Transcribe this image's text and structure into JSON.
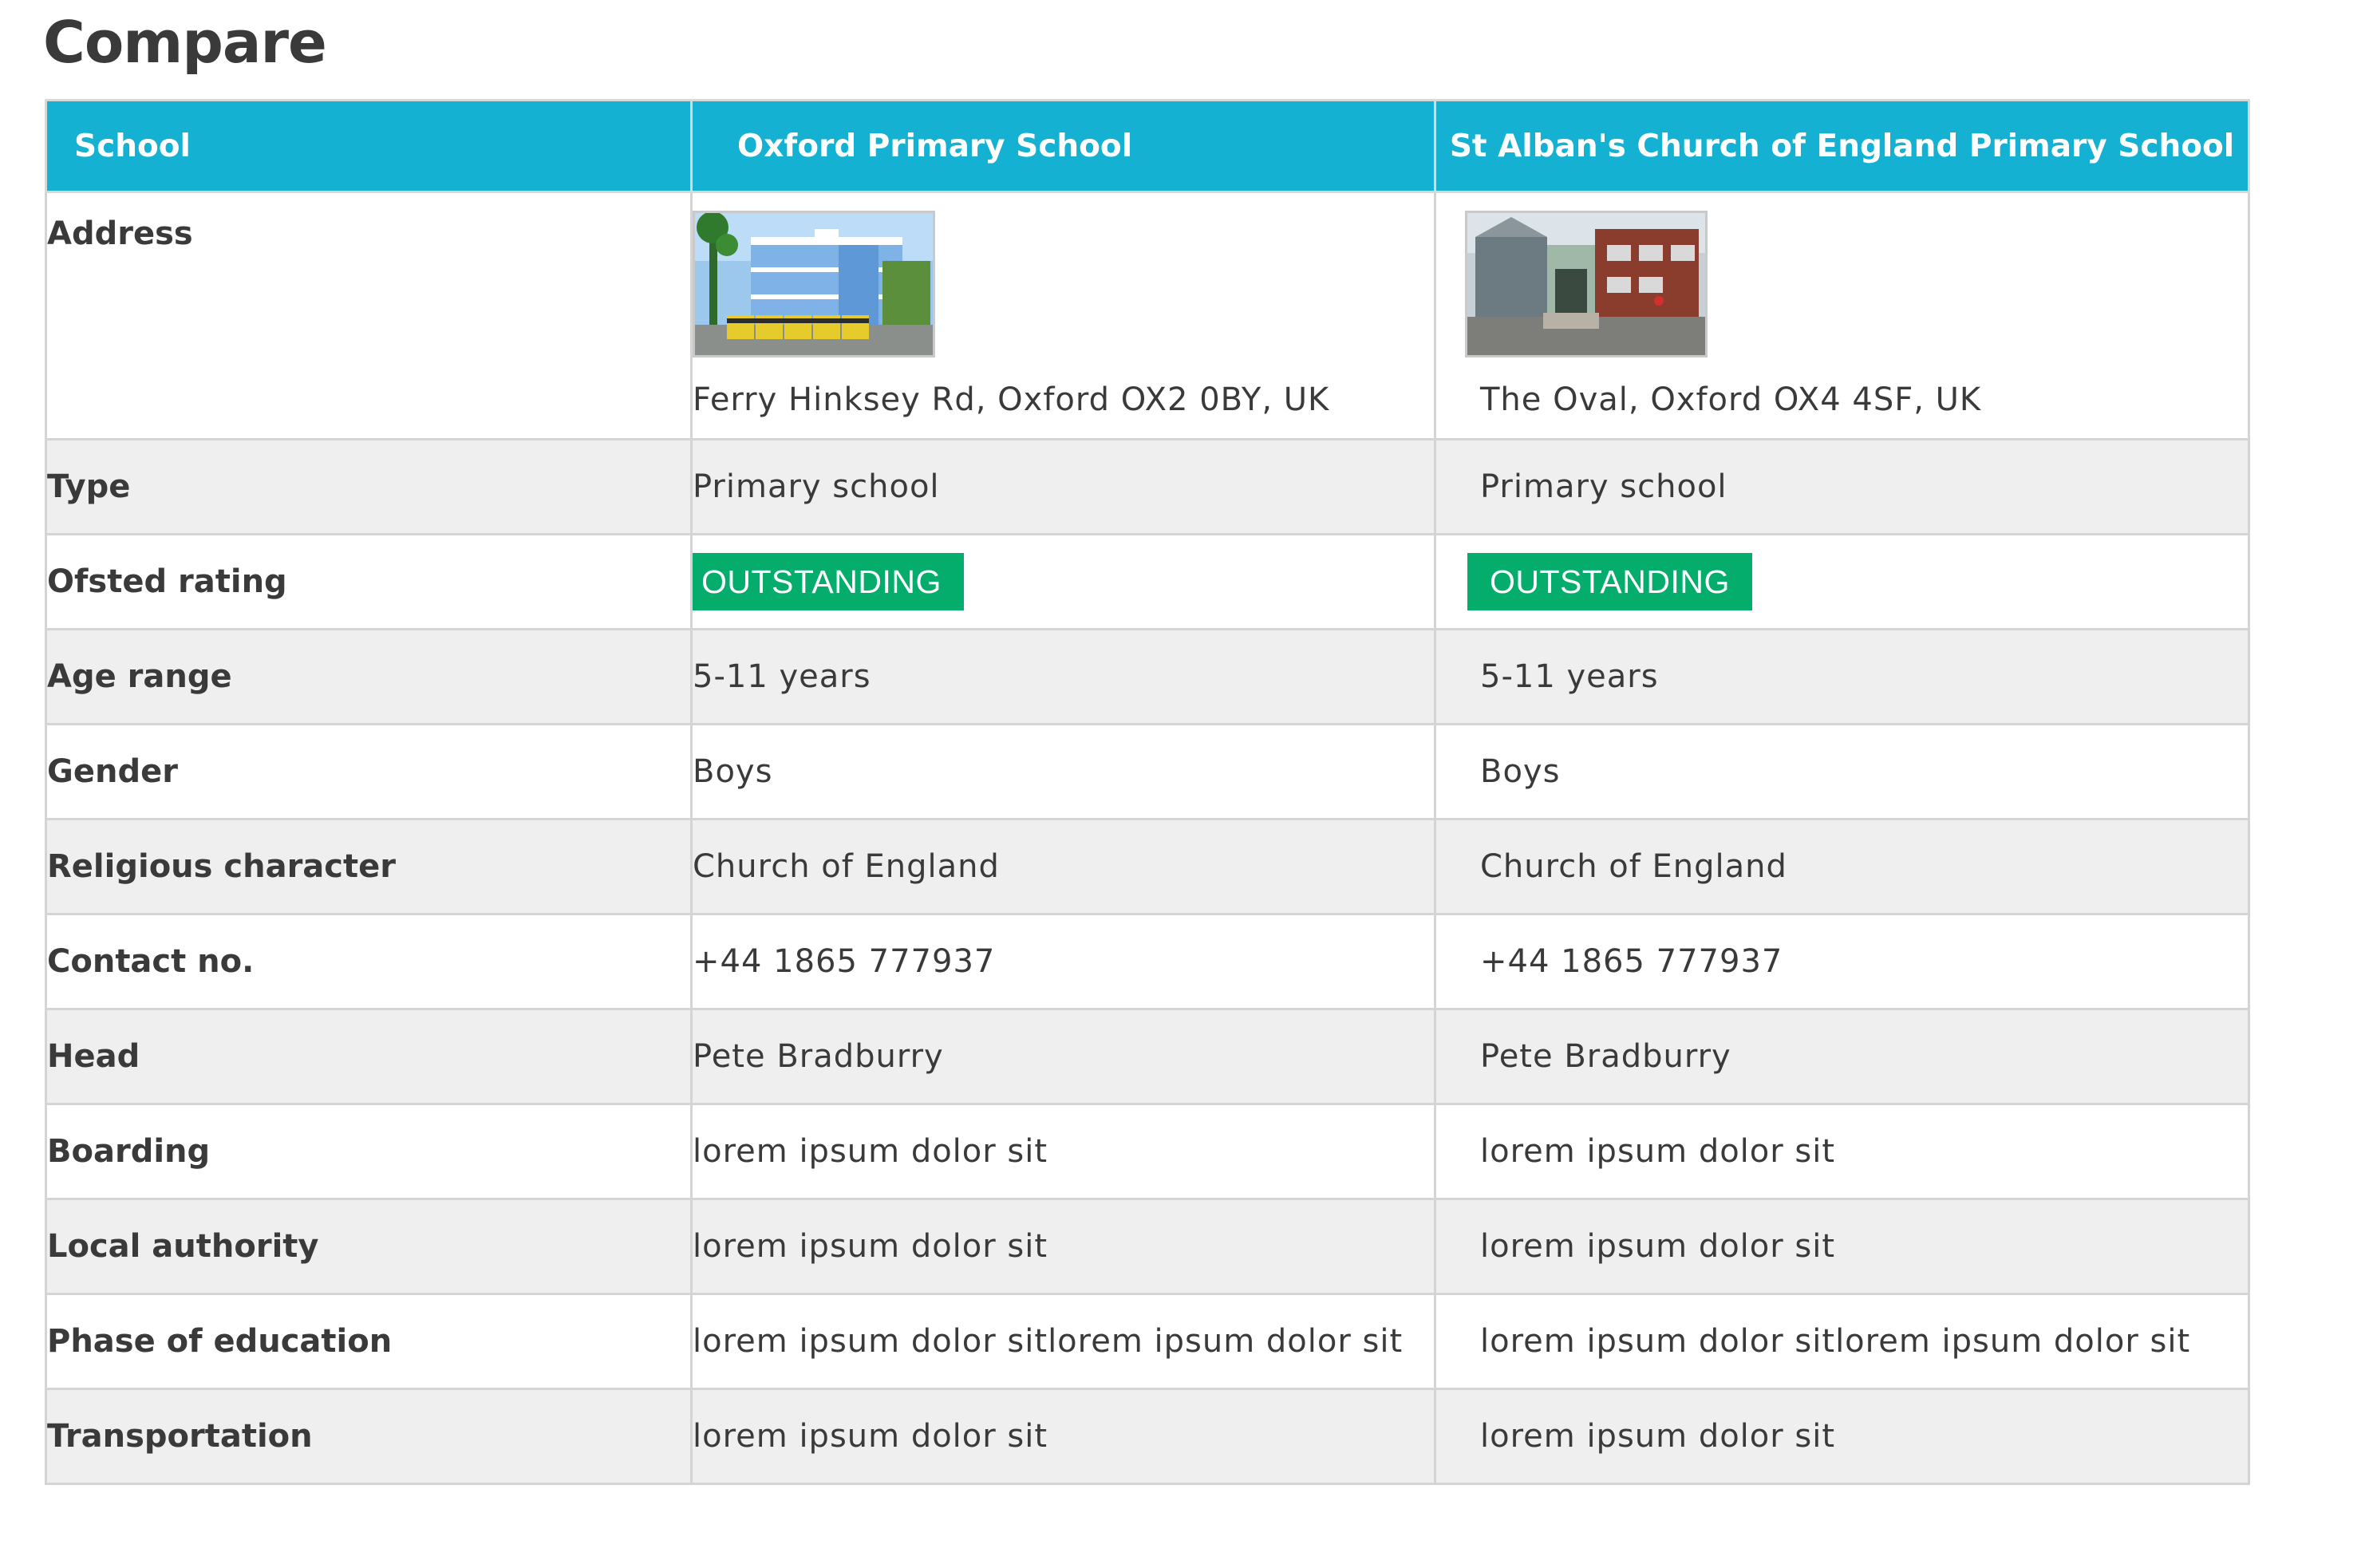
{
  "page": {
    "title": "Compare"
  },
  "table": {
    "headers": {
      "label": "School",
      "school_a": "Oxford Primary School",
      "school_b": "St Alban's Church of England Primary School"
    },
    "address": {
      "label": "Address",
      "school_a": "Ferry Hinksey Rd, Oxford OX2 0BY, UK",
      "school_b": "The Oval, Oxford OX4 4SF, UK"
    },
    "type": {
      "label": "Type",
      "school_a": "Primary school",
      "school_b": "Primary school"
    },
    "ofsted": {
      "label": "Ofsted rating",
      "school_a": "OUTSTANDING",
      "school_b": "OUTSTANDING",
      "badge_color": "#05ad6c"
    },
    "age_range": {
      "label": "Age range",
      "school_a": "5-11 years",
      "school_b": "5-11 years"
    },
    "gender": {
      "label": "Gender",
      "school_a": "Boys",
      "school_b": "Boys"
    },
    "religious": {
      "label": "Religious character",
      "school_a": "Church of England",
      "school_b": "Church of England"
    },
    "contact": {
      "label": "Contact no.",
      "school_a": "+44 1865 777937",
      "school_b": "+44 1865 777937"
    },
    "head": {
      "label": "Head",
      "school_a": "Pete Bradburry",
      "school_b": "Pete Bradburry"
    },
    "boarding": {
      "label": "Boarding",
      "school_a": "lorem ipsum dolor sit",
      "school_b": "lorem ipsum dolor sit"
    },
    "local_authority": {
      "label": "Local authority",
      "school_a": "lorem ipsum dolor sit",
      "school_b": "lorem ipsum dolor sit"
    },
    "phase": {
      "label": "Phase of education",
      "school_a": "lorem ipsum dolor sitlorem ipsum dolor sit",
      "school_b": "lorem ipsum dolor sitlorem ipsum dolor sit"
    },
    "transportation": {
      "label": "Transportation",
      "school_a": "lorem ipsum dolor sit",
      "school_b": "lorem ipsum dolor sit"
    }
  },
  "colors": {
    "header_bg": "#14b1d2",
    "header_text": "#ffffff",
    "row_alt_bg": "#efefef",
    "badge_bg": "#05ad6c"
  }
}
